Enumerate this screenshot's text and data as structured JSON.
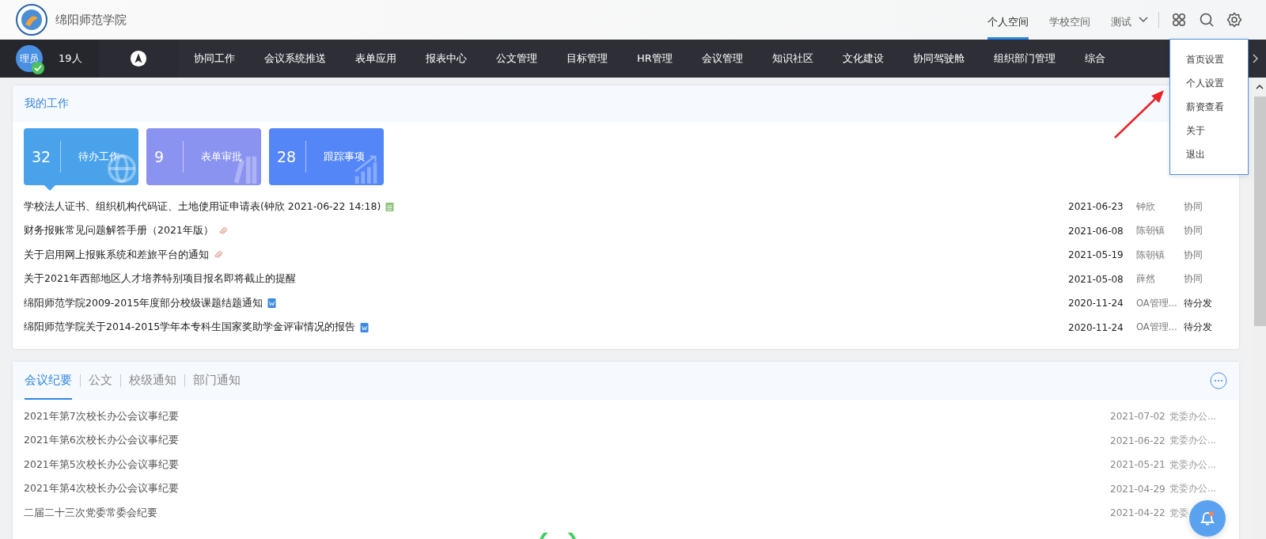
{
  "header": {
    "school_name": "绵阳师范学院",
    "spaces": [
      {
        "label": "个人空间",
        "selected": true
      },
      {
        "label": "学校空间",
        "selected": false
      },
      {
        "label": "测试",
        "selected": false
      }
    ]
  },
  "nav": {
    "avatar_text": "理员",
    "online_count": "19人",
    "items": [
      "协同工作",
      "会议系统推送",
      "表单应用",
      "报表中心",
      "公文管理",
      "目标管理",
      "HR管理",
      "会议管理",
      "知识社区",
      "文化建设",
      "协同驾驶舱",
      "组织部门管理",
      "综合"
    ]
  },
  "settings_menu": [
    "首页设置",
    "个人设置",
    "薪资查看",
    "关于",
    "退出"
  ],
  "my_work": {
    "title": "我的工作",
    "cards": [
      {
        "count": "32",
        "label": "待办工作",
        "color": "#4aa3ea",
        "selected": true,
        "kind": "globe"
      },
      {
        "count": "9",
        "label": "表单审批",
        "color": "#8a93f0",
        "selected": false,
        "kind": "books"
      },
      {
        "count": "28",
        "label": "跟踪事项",
        "color": "#5486f7",
        "selected": false,
        "kind": "chart"
      }
    ],
    "rows": [
      {
        "title": "学校法人证书、组织机构代码证、土地使用证申请表(钟欣 2021-06-22 14:18)",
        "kind": "form",
        "date": "2021-06-23",
        "person": "钟欣",
        "type": "协同",
        "pending": false
      },
      {
        "title": "财务报账常见问题解答手册（2021年版）",
        "kind": "clip",
        "date": "2021-06-08",
        "person": "陈朝镇",
        "type": "协同",
        "pending": false
      },
      {
        "title": "关于启用网上报账系统和差旅平台的通知",
        "kind": "clip",
        "date": "2021-05-19",
        "person": "陈朝镇",
        "type": "协同",
        "pending": false
      },
      {
        "title": "关于2021年西部地区人才培养特别项目报名即将截止的提醒",
        "kind": "plain",
        "date": "2021-05-08",
        "person": "薛然",
        "type": "协同",
        "pending": false
      },
      {
        "title": "绵阳师范学院2009-2015年度部分校级课题结题通知",
        "kind": "word",
        "date": "2020-11-24",
        "person": "OA管理...",
        "type": "待分发",
        "pending": true
      },
      {
        "title": "绵阳师范学院关于2014-2015学年本专科生国家奖助学金评审情况的报告",
        "kind": "word",
        "date": "2020-11-24",
        "person": "OA管理...",
        "type": "待分发",
        "pending": true
      }
    ]
  },
  "notices": {
    "tabs": [
      {
        "label": "会议纪要",
        "selected": true
      },
      {
        "label": "公文",
        "selected": false
      },
      {
        "label": "校级通知",
        "selected": false
      },
      {
        "label": "部门通知",
        "selected": false
      }
    ],
    "rows": [
      {
        "title": "2021年第7次校长办公会议事纪要",
        "date": "2021-07-02",
        "department": "党委办公..."
      },
      {
        "title": "2021年第6次校长办公会议事纪要",
        "date": "2021-06-22",
        "department": "党委办公..."
      },
      {
        "title": "2021年第5次校长办公会议事纪要",
        "date": "2021-05-21",
        "department": "党委办公..."
      },
      {
        "title": "2021年第4次校长办公会议事纪要",
        "date": "2021-04-29",
        "department": "党委办公..."
      },
      {
        "title": "二届二十三次党委常委会纪要",
        "date": "2021-04-22",
        "department": "党委"
      }
    ]
  }
}
